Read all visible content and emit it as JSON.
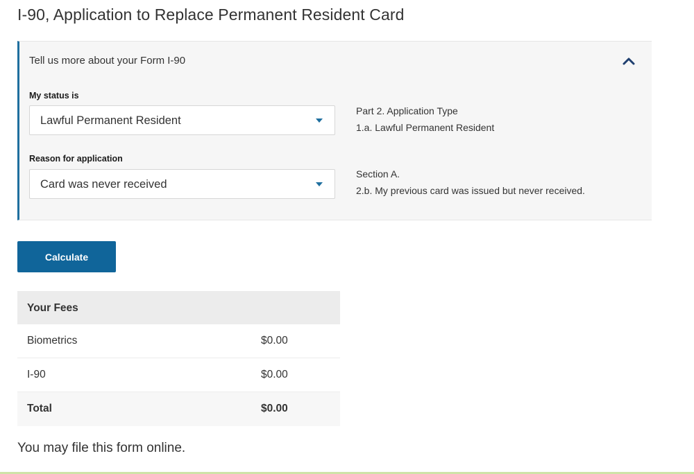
{
  "page": {
    "title": "I-90, Application to Replace Permanent Resident Card"
  },
  "panel": {
    "header": "Tell us more about your Form I-90",
    "collapse_icon": "chevron-up-icon",
    "accent_color": "#1f6f9f",
    "status": {
      "label": "My status is",
      "value": "Lawful Permanent Resident",
      "note_line1": "Part 2. Application Type",
      "note_line2": "1.a. Lawful Permanent Resident"
    },
    "reason": {
      "label": "Reason for application",
      "value": "Card was never received",
      "note_line1": "Section A.",
      "note_line2": "2.b. My previous card was issued but never received."
    }
  },
  "calculate_button": {
    "label": "Calculate",
    "color": "#10659a"
  },
  "fees": {
    "header": "Your Fees",
    "rows": [
      {
        "name": "Biometrics",
        "amount": "$0.00"
      },
      {
        "name": "I-90",
        "amount": "$0.00"
      }
    ],
    "total": {
      "name": "Total",
      "amount": "$0.00"
    }
  },
  "footer": {
    "text": "You may file this form online."
  }
}
